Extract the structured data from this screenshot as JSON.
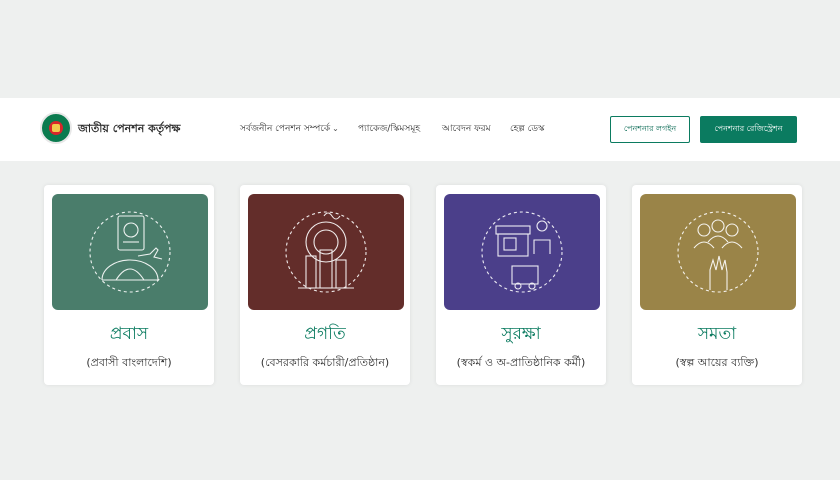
{
  "header": {
    "brand": "জাতীয় পেনশন কর্তৃপক্ষ",
    "nav": [
      "সর্বজনীন পেনশন সম্পর্কে",
      "প্যাকেজ/স্কিমসমূহ",
      "আবেদন ফরম",
      "হেল্প ডেস্ক"
    ],
    "login_label": "পেনশনার লগইন",
    "register_label": "পেনশনার রেজিস্ট্রেশন"
  },
  "schemes": [
    {
      "title": "প্রবাস",
      "subtitle": "(প্রবাসী বাংলাদেশি)",
      "icon": "passport-globe-icon",
      "color": "#4a7d6b"
    },
    {
      "title": "প্রগতি",
      "subtitle": "(বেসরকারি কর্মচারী/প্রতিষ্ঠান)",
      "icon": "factory-gear-icon",
      "color": "#632d2a"
    },
    {
      "title": "সুরক্ষা",
      "subtitle": "(স্বকর্ম ও অ-প্রাতিষ্ঠানিক কর্মী)",
      "icon": "shop-worker-icon",
      "color": "#4b3f8a"
    },
    {
      "title": "সমতা",
      "subtitle": "(স্বল্প আয়ের ব্যক্তি)",
      "icon": "raised-hands-icon",
      "color": "#9a8448"
    }
  ],
  "colors": {
    "accent": "#0b7b60",
    "background": "#eef0ef"
  }
}
